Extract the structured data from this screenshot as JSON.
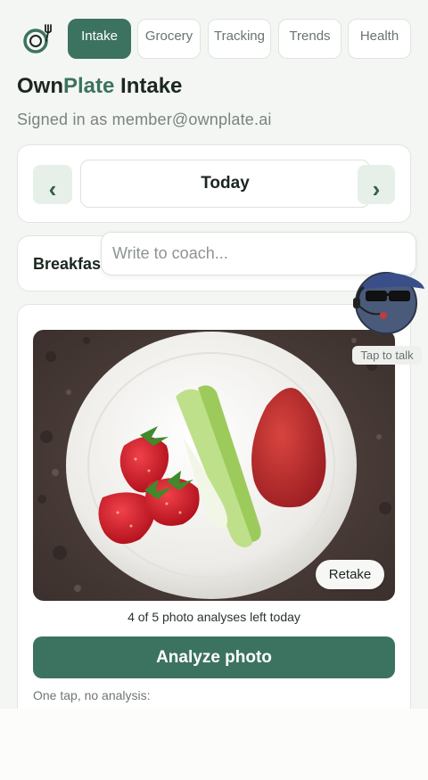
{
  "nav": {
    "tabs": [
      {
        "label": "Intake",
        "active": true
      },
      {
        "label": "Grocery",
        "active": false
      },
      {
        "label": "Tracking",
        "active": false
      },
      {
        "label": "Trends",
        "active": false
      },
      {
        "label": "Health",
        "active": false
      }
    ],
    "logo_icon": "plate-fork-icon"
  },
  "header": {
    "title_part1": "Own",
    "title_brand": "Plate",
    "title_part2": " Intake",
    "signed_in": "Signed in as member@ownplate.ai"
  },
  "date_selector": {
    "prev_label": "‹",
    "current": "Today",
    "next_label": "›"
  },
  "meal": {
    "label": "Breakfast"
  },
  "coach": {
    "input_placeholder": "Write to coach...",
    "avatar_icon": "coach-avatar-icon",
    "talk_label": "Tap to talk"
  },
  "photo": {
    "retake_label": "Retake",
    "quota_text": "4 of 5 photo analyses left today",
    "analyze_label": "Analyze photo",
    "one_tap_text": "One tap, no analysis:"
  },
  "colors": {
    "accent": "#3c7360",
    "background": "#f4f6f3"
  }
}
